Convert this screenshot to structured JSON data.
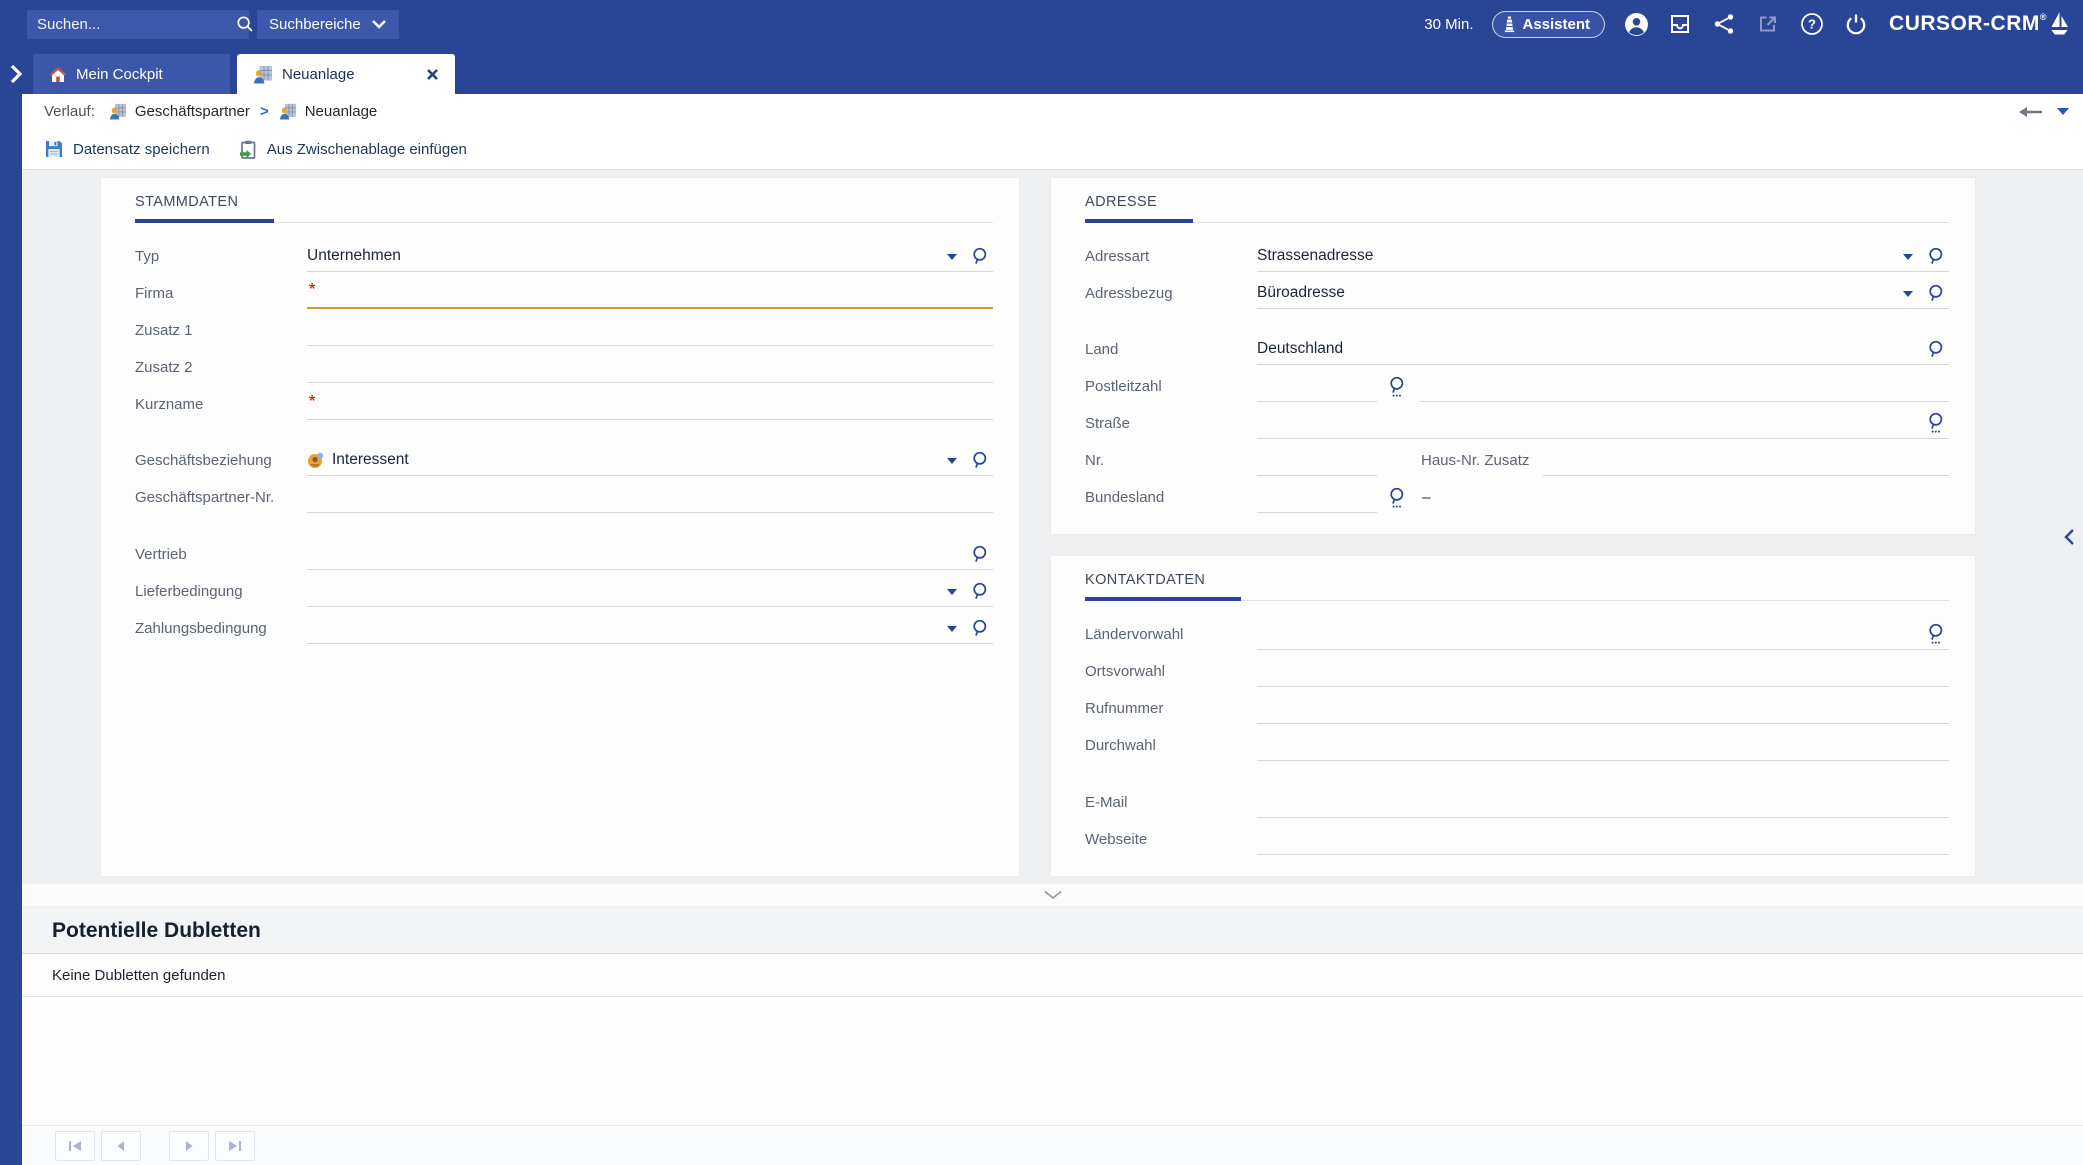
{
  "topbar": {
    "search_placeholder": "Suchen...",
    "search_scope_label": "Suchbereiche",
    "session_timer": "30 Min.",
    "assistant_label": "Assistent",
    "logo_text": "CURSOR-CRM",
    "logo_mark": "®",
    "icons": [
      "account",
      "inbox",
      "share",
      "external-link",
      "help",
      "power",
      "sailboat-logo"
    ]
  },
  "tabs": [
    {
      "label": "Mein Cockpit",
      "icon": "home",
      "active": false
    },
    {
      "label": "Neuanlage",
      "icon": "business-partner",
      "active": true,
      "closable": true
    }
  ],
  "breadcrumb": {
    "label": "Verlauf:",
    "separator": ">",
    "items": [
      {
        "label": "Geschäftspartner",
        "icon": "business-partner"
      },
      {
        "label": "Neuanlage",
        "icon": "business-partner"
      }
    ]
  },
  "toolbar": {
    "save_label": "Datensatz speichern",
    "paste_label": "Aus Zwischenablage einfügen"
  },
  "stammdaten": {
    "title": "STAMMDATEN",
    "fields": {
      "typ": {
        "label": "Typ",
        "value": "Unternehmen"
      },
      "firma": {
        "label": "Firma",
        "value": "",
        "required_marker": "*"
      },
      "zusatz1": {
        "label": "Zusatz 1",
        "value": ""
      },
      "zusatz2": {
        "label": "Zusatz 2",
        "value": ""
      },
      "kurzname": {
        "label": "Kurzname",
        "value": "",
        "required_marker": "*"
      },
      "geschaeftsbeziehung": {
        "label": "Geschäftsbeziehung",
        "value": "Interessent"
      },
      "geschaeftspartner_nr": {
        "label": "Geschäftspartner-Nr.",
        "value": ""
      },
      "vertrieb": {
        "label": "Vertrieb",
        "value": ""
      },
      "lieferbedingung": {
        "label": "Lieferbedingung",
        "value": ""
      },
      "zahlungsbedingung": {
        "label": "Zahlungsbedingung",
        "value": ""
      }
    }
  },
  "adresse": {
    "title": "ADRESSE",
    "fields": {
      "adressart": {
        "label": "Adressart",
        "value": "Strassenadresse"
      },
      "adressbezug": {
        "label": "Adressbezug",
        "value": "Büroadresse"
      },
      "land": {
        "label": "Land",
        "value": "Deutschland"
      },
      "postleitzahl": {
        "label": "Postleitzahl",
        "value": ""
      },
      "strasse": {
        "label": "Straße",
        "value": ""
      },
      "nr": {
        "label": "Nr.",
        "value": ""
      },
      "hausnr_zusatz": {
        "label": "Haus-Nr. Zusatz",
        "value": ""
      },
      "bundesland": {
        "label": "Bundesland",
        "value": "",
        "suffix": "–"
      }
    }
  },
  "kontaktdaten": {
    "title": "KONTAKTDATEN",
    "fields": {
      "laendervorwahl": {
        "label": "Ländervorwahl",
        "value": ""
      },
      "ortsvorwahl": {
        "label": "Ortsvorwahl",
        "value": ""
      },
      "rufnummer": {
        "label": "Rufnummer",
        "value": ""
      },
      "durchwahl": {
        "label": "Durchwahl",
        "value": ""
      },
      "email": {
        "label": "E-Mail",
        "value": ""
      },
      "webseite": {
        "label": "Webseite",
        "value": ""
      }
    }
  },
  "dubletten": {
    "title": "Potentielle Dubletten",
    "empty_message": "Keine Dubletten gefunden"
  },
  "colors": {
    "topbar": "#2b4596",
    "accent": "#2b4596",
    "tab_inactive": "#3c57a9",
    "required": "#d9342b",
    "focused_underline": "#d49a2e",
    "content_bg": "#eef0f2"
  }
}
